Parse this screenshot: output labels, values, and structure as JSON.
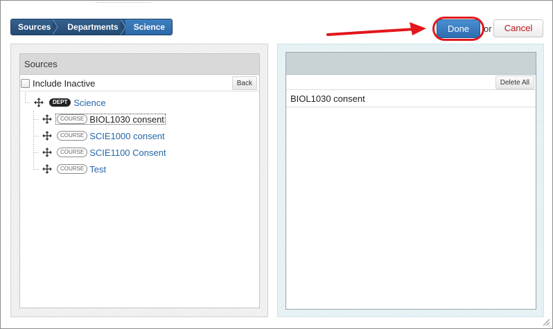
{
  "breadcrumb": {
    "items": [
      {
        "label": "Sources"
      },
      {
        "label": "Departments"
      },
      {
        "label": "Science"
      }
    ]
  },
  "actions": {
    "done_label": "Done",
    "or_label": "or",
    "cancel_label": "Cancel"
  },
  "left_panel": {
    "title": "Sources",
    "include_inactive_label": "Include Inactive",
    "include_inactive_checked": false,
    "back_label": "Back",
    "tree": {
      "department": {
        "badge": "DEPT",
        "label": "Science"
      },
      "courses": [
        {
          "badge": "COURSE",
          "label": "BIOL1030 consent",
          "selected": true
        },
        {
          "badge": "COURSE",
          "label": "SCIE1000 consent",
          "selected": false
        },
        {
          "badge": "COURSE",
          "label": "SCIE1100 Consent",
          "selected": false
        },
        {
          "badge": "COURSE",
          "label": "Test",
          "selected": false
        }
      ]
    }
  },
  "right_panel": {
    "delete_all_label": "Delete All",
    "selected_items": [
      "BIOL1030 consent"
    ]
  },
  "colors": {
    "breadcrumb_bg": "#2a5582",
    "breadcrumb_active": "#3577b8",
    "done_button": "#3a7fc4",
    "cancel_text": "#c0121b",
    "link": "#2466a8",
    "annotation_red": "#e2161b"
  },
  "icons": {
    "move": "move-icon",
    "arrow": "red-arrow-annotation",
    "highlight": "red-circle-annotation",
    "resize": "resize-grip-icon"
  }
}
